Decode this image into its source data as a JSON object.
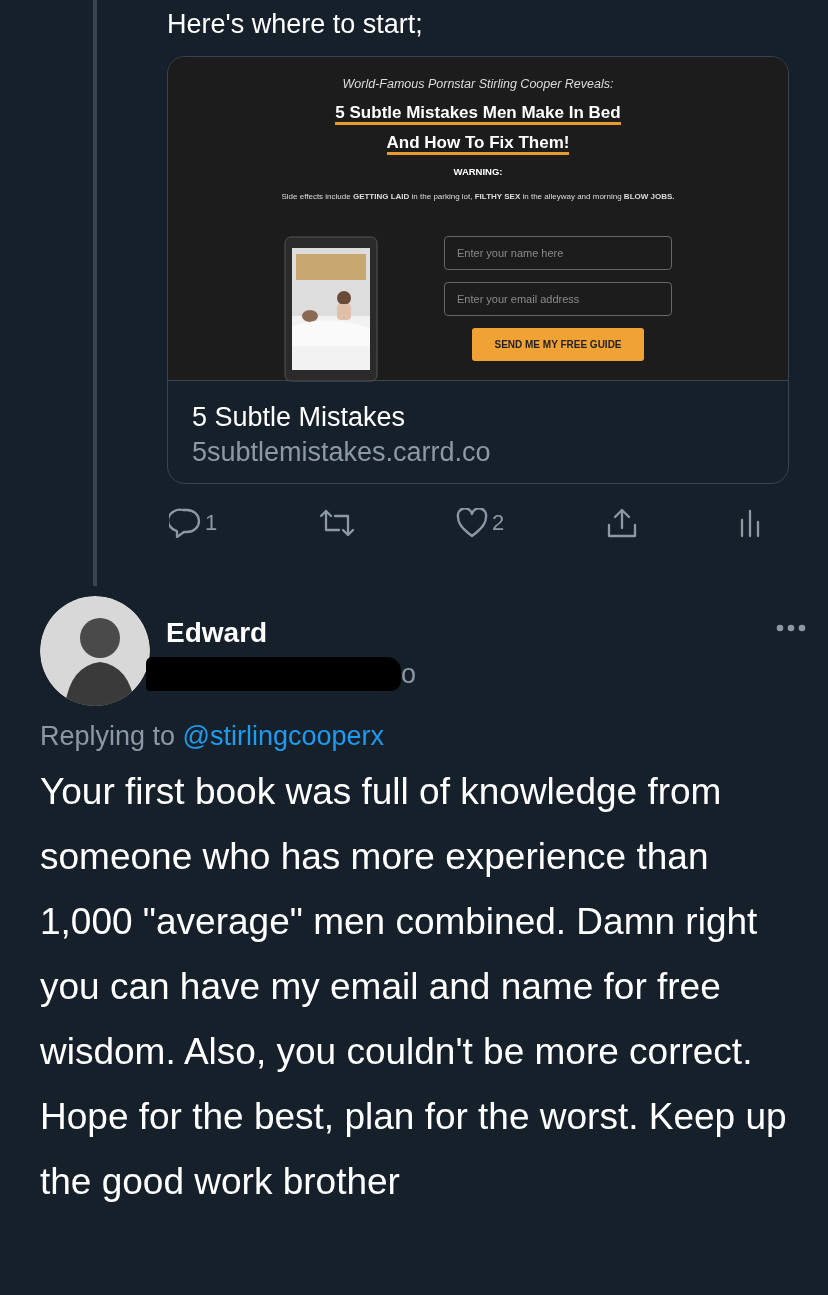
{
  "tweet": {
    "text": "Here's where to start;",
    "card": {
      "page": {
        "kicker": "World-Famous Pornstar Stirling Cooper Reveals:",
        "headline": [
          "5 Subtle Mistakes Men Make In Bed",
          "And How To Fix Them!"
        ],
        "warning_title": "WARNING:",
        "warning_text": "Side effects include **GETTING LAID** in the parking lot, **FILTHY SEX** in the alleyway and morning **BLOW JOBS.**",
        "fields": [
          {
            "placeholder": "Enter your name here"
          },
          {
            "placeholder": "Enter your email address"
          }
        ],
        "button": "SEND ME MY FREE GUIDE"
      },
      "title": "5 Subtle Mistakes",
      "domain": "5subtlemistakes.carrd.co"
    },
    "actions": [
      {
        "kind": "reply",
        "count": "1"
      },
      {
        "kind": "retweet"
      },
      {
        "kind": "like",
        "count": "2"
      },
      {
        "kind": "share"
      },
      {
        "kind": "analytics"
      }
    ]
  },
  "reply": {
    "name": "Edward",
    "handle_visible": "o",
    "replying_label": "Replying to",
    "replying_to": "@stirlingcooperx",
    "text": "Your first book was full of knowledge from someone who has more experience than 1,000 \"average\" men combined. Damn right you can have my email and name for free wisdom. Also, you couldn't be more correct. Hope for the best, plan for the worst. Keep up the good work brother"
  }
}
